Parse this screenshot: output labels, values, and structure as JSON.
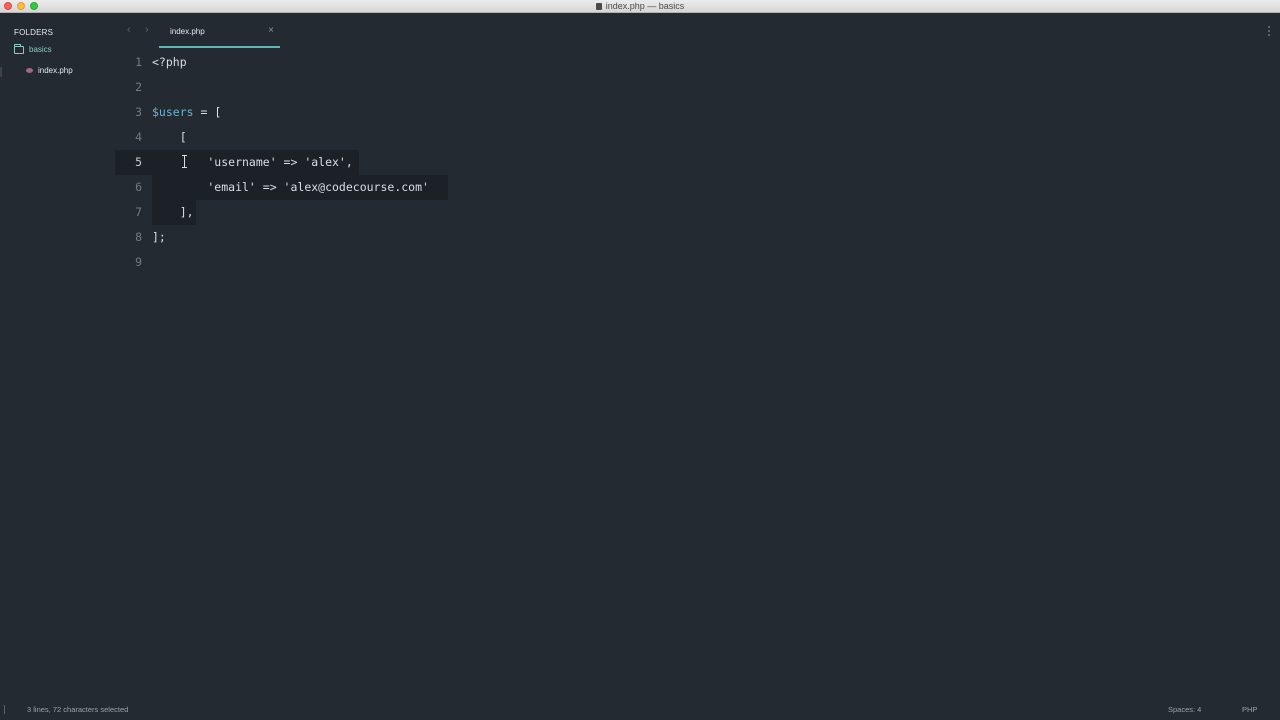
{
  "window": {
    "title": "index.php — basics"
  },
  "sidebar": {
    "header": "FOLDERS",
    "folder": {
      "name": "basics",
      "icon": "folder-icon"
    },
    "files": [
      {
        "name": "index.php",
        "icon": "php-file-icon"
      }
    ]
  },
  "tabs": {
    "prev_icon": "‹",
    "next_icon": "›",
    "items": [
      {
        "label": "index.php",
        "close": "×"
      }
    ]
  },
  "editor": {
    "current_line": 5,
    "selected_lines": [
      5,
      6,
      7
    ],
    "lines": [
      {
        "number": "1",
        "text": "<?php"
      },
      {
        "number": "2",
        "text": ""
      },
      {
        "number": "3",
        "var": "$users",
        "text": " = ["
      },
      {
        "number": "4",
        "text": "    ["
      },
      {
        "number": "5",
        "text": "        'username' => 'alex',"
      },
      {
        "number": "6",
        "text": "        'email' => 'alex@codecourse.com'"
      },
      {
        "number": "7",
        "text": "    ],"
      },
      {
        "number": "8",
        "text": "];"
      },
      {
        "number": "9",
        "text": ""
      }
    ]
  },
  "status": {
    "selection": "3 lines, 72 characters selected",
    "indentation": "Spaces: 4",
    "syntax": "PHP"
  },
  "colors": {
    "background": "#232a31",
    "accent": "#5bb7b0",
    "variable": "#6fb3d2",
    "selection": "#1b2127"
  }
}
